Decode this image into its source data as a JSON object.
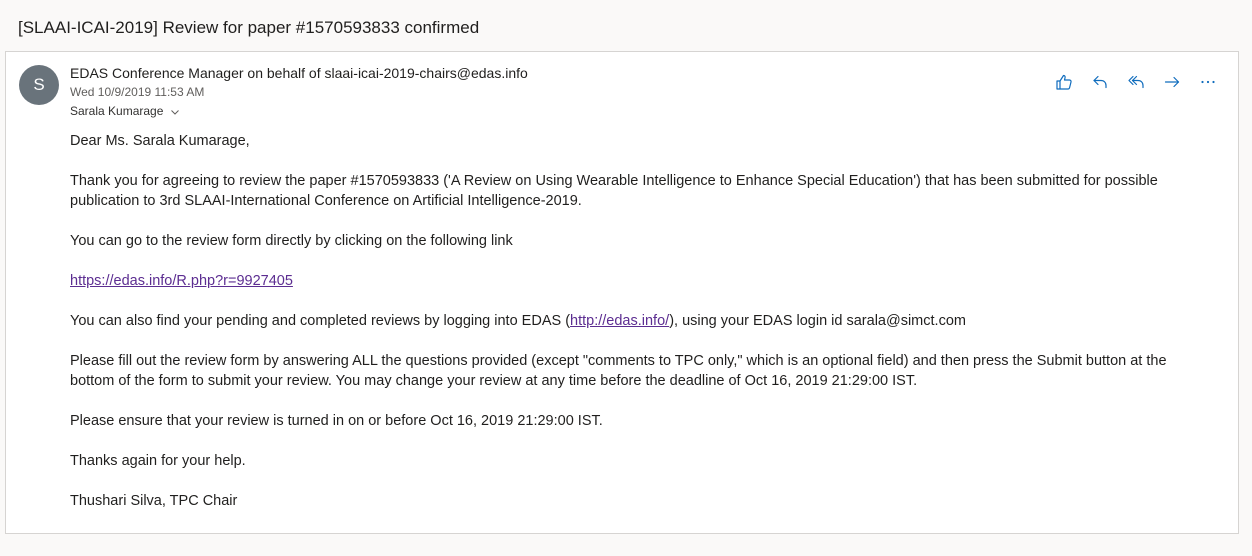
{
  "subject": "[SLAAI-ICAI-2019] Review for paper #1570593833 confirmed",
  "avatar_initial": "S",
  "sender": "EDAS Conference Manager on behalf of slaai-icai-2019-chairs@edas.info",
  "date": "Wed 10/9/2019 11:53 AM",
  "recipient": "Sarala Kumarage",
  "actions": {
    "like": "like-icon",
    "reply": "reply-icon",
    "reply_all": "reply-all-icon",
    "forward": "forward-icon",
    "more": "more-icon"
  },
  "body": {
    "greeting": "Dear Ms. Sarala Kumarage,",
    "para1": "Thank you for agreeing to review the paper #1570593833 ('A Review on Using Wearable Intelligence to Enhance Special Education') that has been submitted for possible publication to 3rd SLAAI-International Conference on Artificial Intelligence-2019.",
    "para2": "You can go to the review form directly by clicking on the following link",
    "review_link": "https://edas.info/R.php?r=9927405",
    "para3_prefix": "You can also find your pending and completed reviews by logging into EDAS (",
    "edas_link": "http://edas.info/",
    "para3_suffix": "), using your EDAS login id sarala@simct.com",
    "para4": "Please fill out the review form by answering ALL the questions provided (except \"comments to TPC only,\" which is an optional field)  and then press the Submit button at the bottom of the form to submit your review. You may change your review at any time before the deadline of Oct 16, 2019 21:29:00 IST.",
    "para5": "Please ensure that your review is turned in on or before Oct 16, 2019 21:29:00 IST.",
    "para6": "Thanks again for your help.",
    "signature": "Thushari Silva, TPC Chair"
  },
  "colors": {
    "accent": "#0f6cbd",
    "link_visited": "#5c2d91",
    "avatar_bg": "#69737b",
    "page_bg": "#faf9f8"
  }
}
